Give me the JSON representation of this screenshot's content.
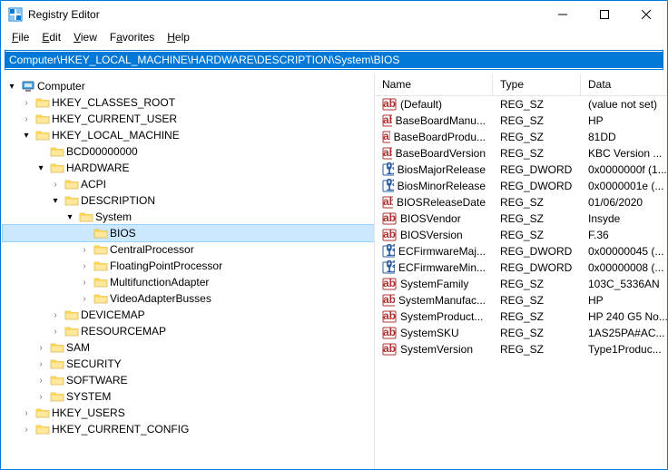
{
  "window": {
    "title": "Registry Editor"
  },
  "menu": {
    "file": "File",
    "edit": "Edit",
    "view": "View",
    "favorites": "Favorites",
    "help": "Help"
  },
  "address": {
    "value": "Computer\\HKEY_LOCAL_MACHINE\\HARDWARE\\DESCRIPTION\\System\\BIOS"
  },
  "tree": {
    "root": "Computer",
    "hkcr": "HKEY_CLASSES_ROOT",
    "hkcu": "HKEY_CURRENT_USER",
    "hklm": "HKEY_LOCAL_MACHINE",
    "bcd": "BCD00000000",
    "hardware": "HARDWARE",
    "acpi": "ACPI",
    "description": "DESCRIPTION",
    "system": "System",
    "bios": "BIOS",
    "centralprocessor": "CentralProcessor",
    "floatingpoint": "FloatingPointProcessor",
    "multifunction": "MultifunctionAdapter",
    "videoadapter": "VideoAdapterBusses",
    "devicemap": "DEVICEMAP",
    "resourcemap": "RESOURCEMAP",
    "sam": "SAM",
    "security": "SECURITY",
    "software": "SOFTWARE",
    "system2": "SYSTEM",
    "hku": "HKEY_USERS",
    "hkcc": "HKEY_CURRENT_CONFIG"
  },
  "columns": {
    "name": "Name",
    "type": "Type",
    "data": "Data"
  },
  "values": [
    {
      "icon": "sz",
      "name": "(Default)",
      "type": "REG_SZ",
      "data": "(value not set)"
    },
    {
      "icon": "sz",
      "name": "BaseBoardManu...",
      "type": "REG_SZ",
      "data": "HP"
    },
    {
      "icon": "sz",
      "name": "BaseBoardProdu...",
      "type": "REG_SZ",
      "data": "81DD"
    },
    {
      "icon": "sz",
      "name": "BaseBoardVersion",
      "type": "REG_SZ",
      "data": "KBC Version ..."
    },
    {
      "icon": "dw",
      "name": "BiosMajorRelease",
      "type": "REG_DWORD",
      "data": "0x0000000f (1..."
    },
    {
      "icon": "dw",
      "name": "BiosMinorRelease",
      "type": "REG_DWORD",
      "data": "0x0000001e (..."
    },
    {
      "icon": "sz",
      "name": "BIOSReleaseDate",
      "type": "REG_SZ",
      "data": "01/06/2020"
    },
    {
      "icon": "sz",
      "name": "BIOSVendor",
      "type": "REG_SZ",
      "data": "Insyde"
    },
    {
      "icon": "sz",
      "name": "BIOSVersion",
      "type": "REG_SZ",
      "data": "F.36"
    },
    {
      "icon": "dw",
      "name": "ECFirmwareMaj...",
      "type": "REG_DWORD",
      "data": "0x00000045 (..."
    },
    {
      "icon": "dw",
      "name": "ECFirmwareMin...",
      "type": "REG_DWORD",
      "data": "0x00000008 (..."
    },
    {
      "icon": "sz",
      "name": "SystemFamily",
      "type": "REG_SZ",
      "data": "103C_5336AN"
    },
    {
      "icon": "sz",
      "name": "SystemManufac...",
      "type": "REG_SZ",
      "data": "HP"
    },
    {
      "icon": "sz",
      "name": "SystemProduct...",
      "type": "REG_SZ",
      "data": "HP 240 G5 No..."
    },
    {
      "icon": "sz",
      "name": "SystemSKU",
      "type": "REG_SZ",
      "data": "1AS25PA#AC..."
    },
    {
      "icon": "sz",
      "name": "SystemVersion",
      "type": "REG_SZ",
      "data": "Type1Produc..."
    }
  ]
}
